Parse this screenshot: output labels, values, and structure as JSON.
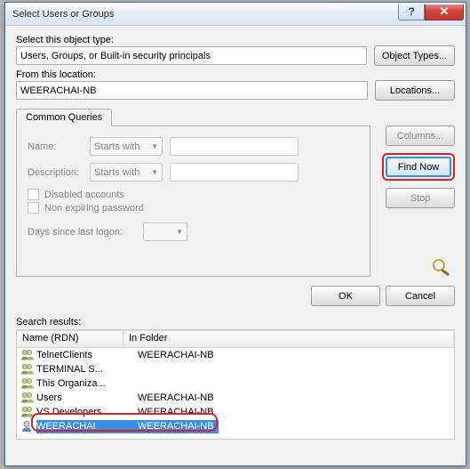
{
  "title": "Select Users or Groups",
  "labels": {
    "object_type": "Select this object type:",
    "from_location": "From this location:",
    "search_results": "Search results:",
    "name_col": "Name (RDN)",
    "folder_col": "In Folder"
  },
  "fields": {
    "object_type_value": "Users, Groups, or Built-in security principals",
    "location_value": "WEERACHAI-NB"
  },
  "buttons": {
    "object_types": "Object Types...",
    "locations": "Locations...",
    "columns": "Columns...",
    "find_now": "Find Now",
    "stop": "Stop",
    "ok": "OK",
    "cancel": "Cancel"
  },
  "tab": {
    "label": "Common Queries",
    "name_lbl": "Name:",
    "desc_lbl": "Description:",
    "starts_with": "Starts with",
    "disabled": "Disabled accounts",
    "nonexp": "Non expiring password",
    "days": "Days since last logon:"
  },
  "results": [
    {
      "icon": "group",
      "name": "TelnetClients",
      "folder": "WEERACHAI-NB"
    },
    {
      "icon": "group",
      "name": "TERMINAL S...",
      "folder": ""
    },
    {
      "icon": "group",
      "name": "This Organiza...",
      "folder": ""
    },
    {
      "icon": "group",
      "name": "Users",
      "folder": "WEERACHAI-NB"
    },
    {
      "icon": "group",
      "name": "VS Developers",
      "folder": "WEERACHAI-NB"
    },
    {
      "icon": "user",
      "name": "WEERACHAI",
      "folder": "WEERACHAI-NB",
      "selected": true
    }
  ]
}
